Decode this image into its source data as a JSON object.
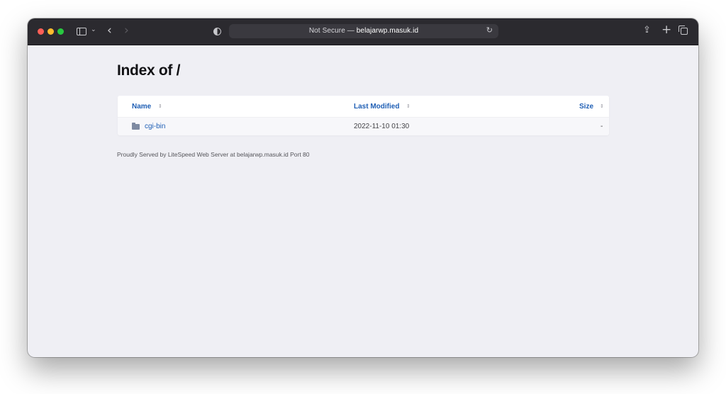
{
  "browser": {
    "address": {
      "security_label": "Not Secure",
      "separator": "—",
      "host": "belajarwp.masuk.id"
    },
    "icons": {
      "sidebar": "sidebar-icon",
      "chevron": "chevron-down-icon",
      "back": "back-arrow-icon",
      "forward": "forward-arrow-icon",
      "privacy": "privacy-shield-icon",
      "reload": "reload-icon",
      "share": "share-icon",
      "new_tab": "plus-icon",
      "tabs": "tab-overview-icon"
    }
  },
  "page": {
    "title": "Index of /",
    "table": {
      "columns": [
        {
          "label": "Name",
          "sort_glyph": "⇕"
        },
        {
          "label": "Last Modified",
          "sort_glyph": "⇕"
        },
        {
          "label": "Size",
          "sort_glyph": "⇕"
        }
      ],
      "rows": [
        {
          "icon": "folder-icon",
          "name": "cgi-bin",
          "modified": "2022-11-10 01:30",
          "size": "-"
        }
      ]
    },
    "footer": "Proudly Served by LiteSpeed Web Server at belajarwp.masuk.id Port 80"
  },
  "colors": {
    "toolbar": "#2b2a2f",
    "page_background": "#efeff4",
    "link": "#1f5fb5"
  }
}
